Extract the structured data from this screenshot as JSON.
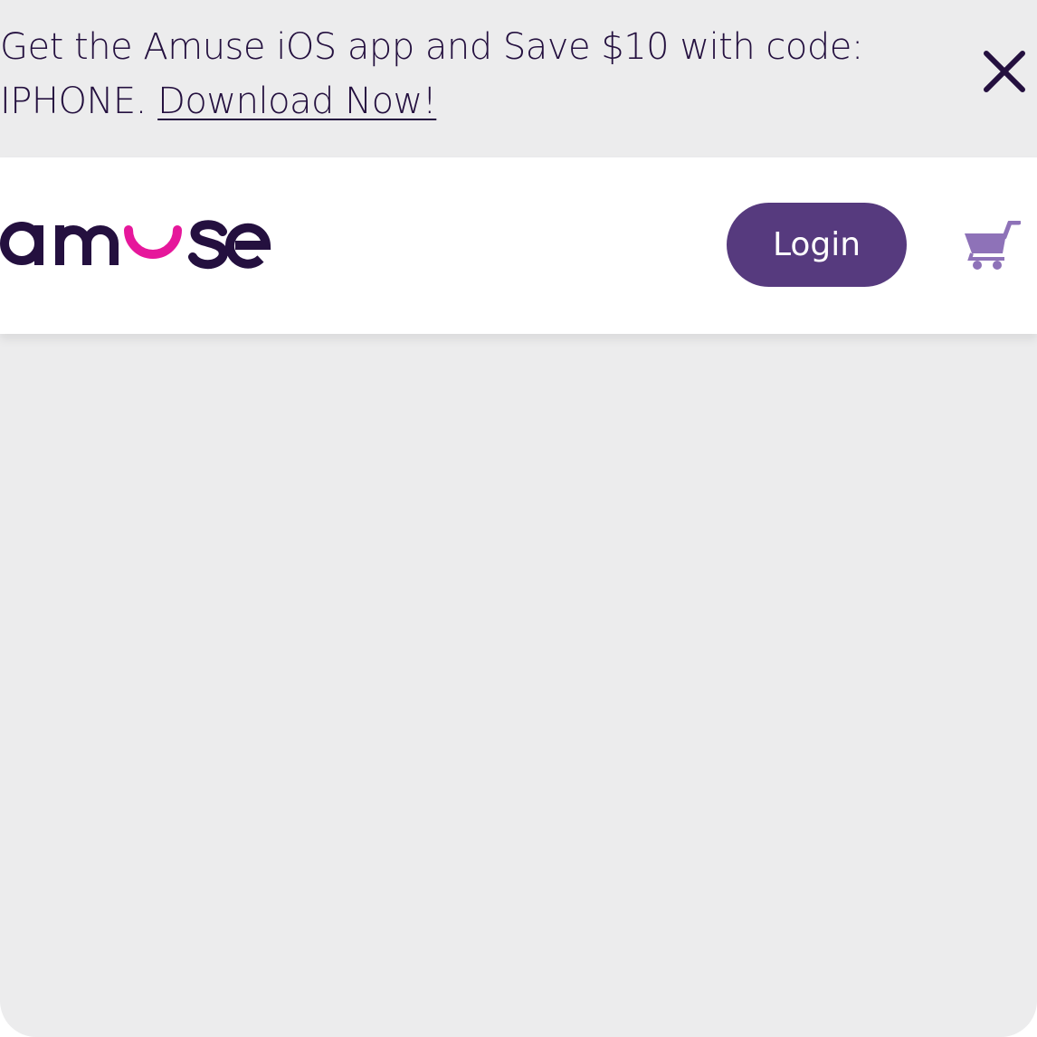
{
  "promo_banner": {
    "message": "Get the Amuse iOS app and Save $10 with code: IPHONE. ",
    "link_label": "Download Now!",
    "close_icon": "close-icon"
  },
  "header": {
    "logo_text": "amuse",
    "login_label": "Login",
    "cart_icon": "cart-icon"
  },
  "colors": {
    "brand_dark": "#24103f",
    "brand_pink": "#e6179b",
    "login_bg": "#563a7e",
    "cart": "#8e72b8",
    "page_bg": "#ececed"
  }
}
